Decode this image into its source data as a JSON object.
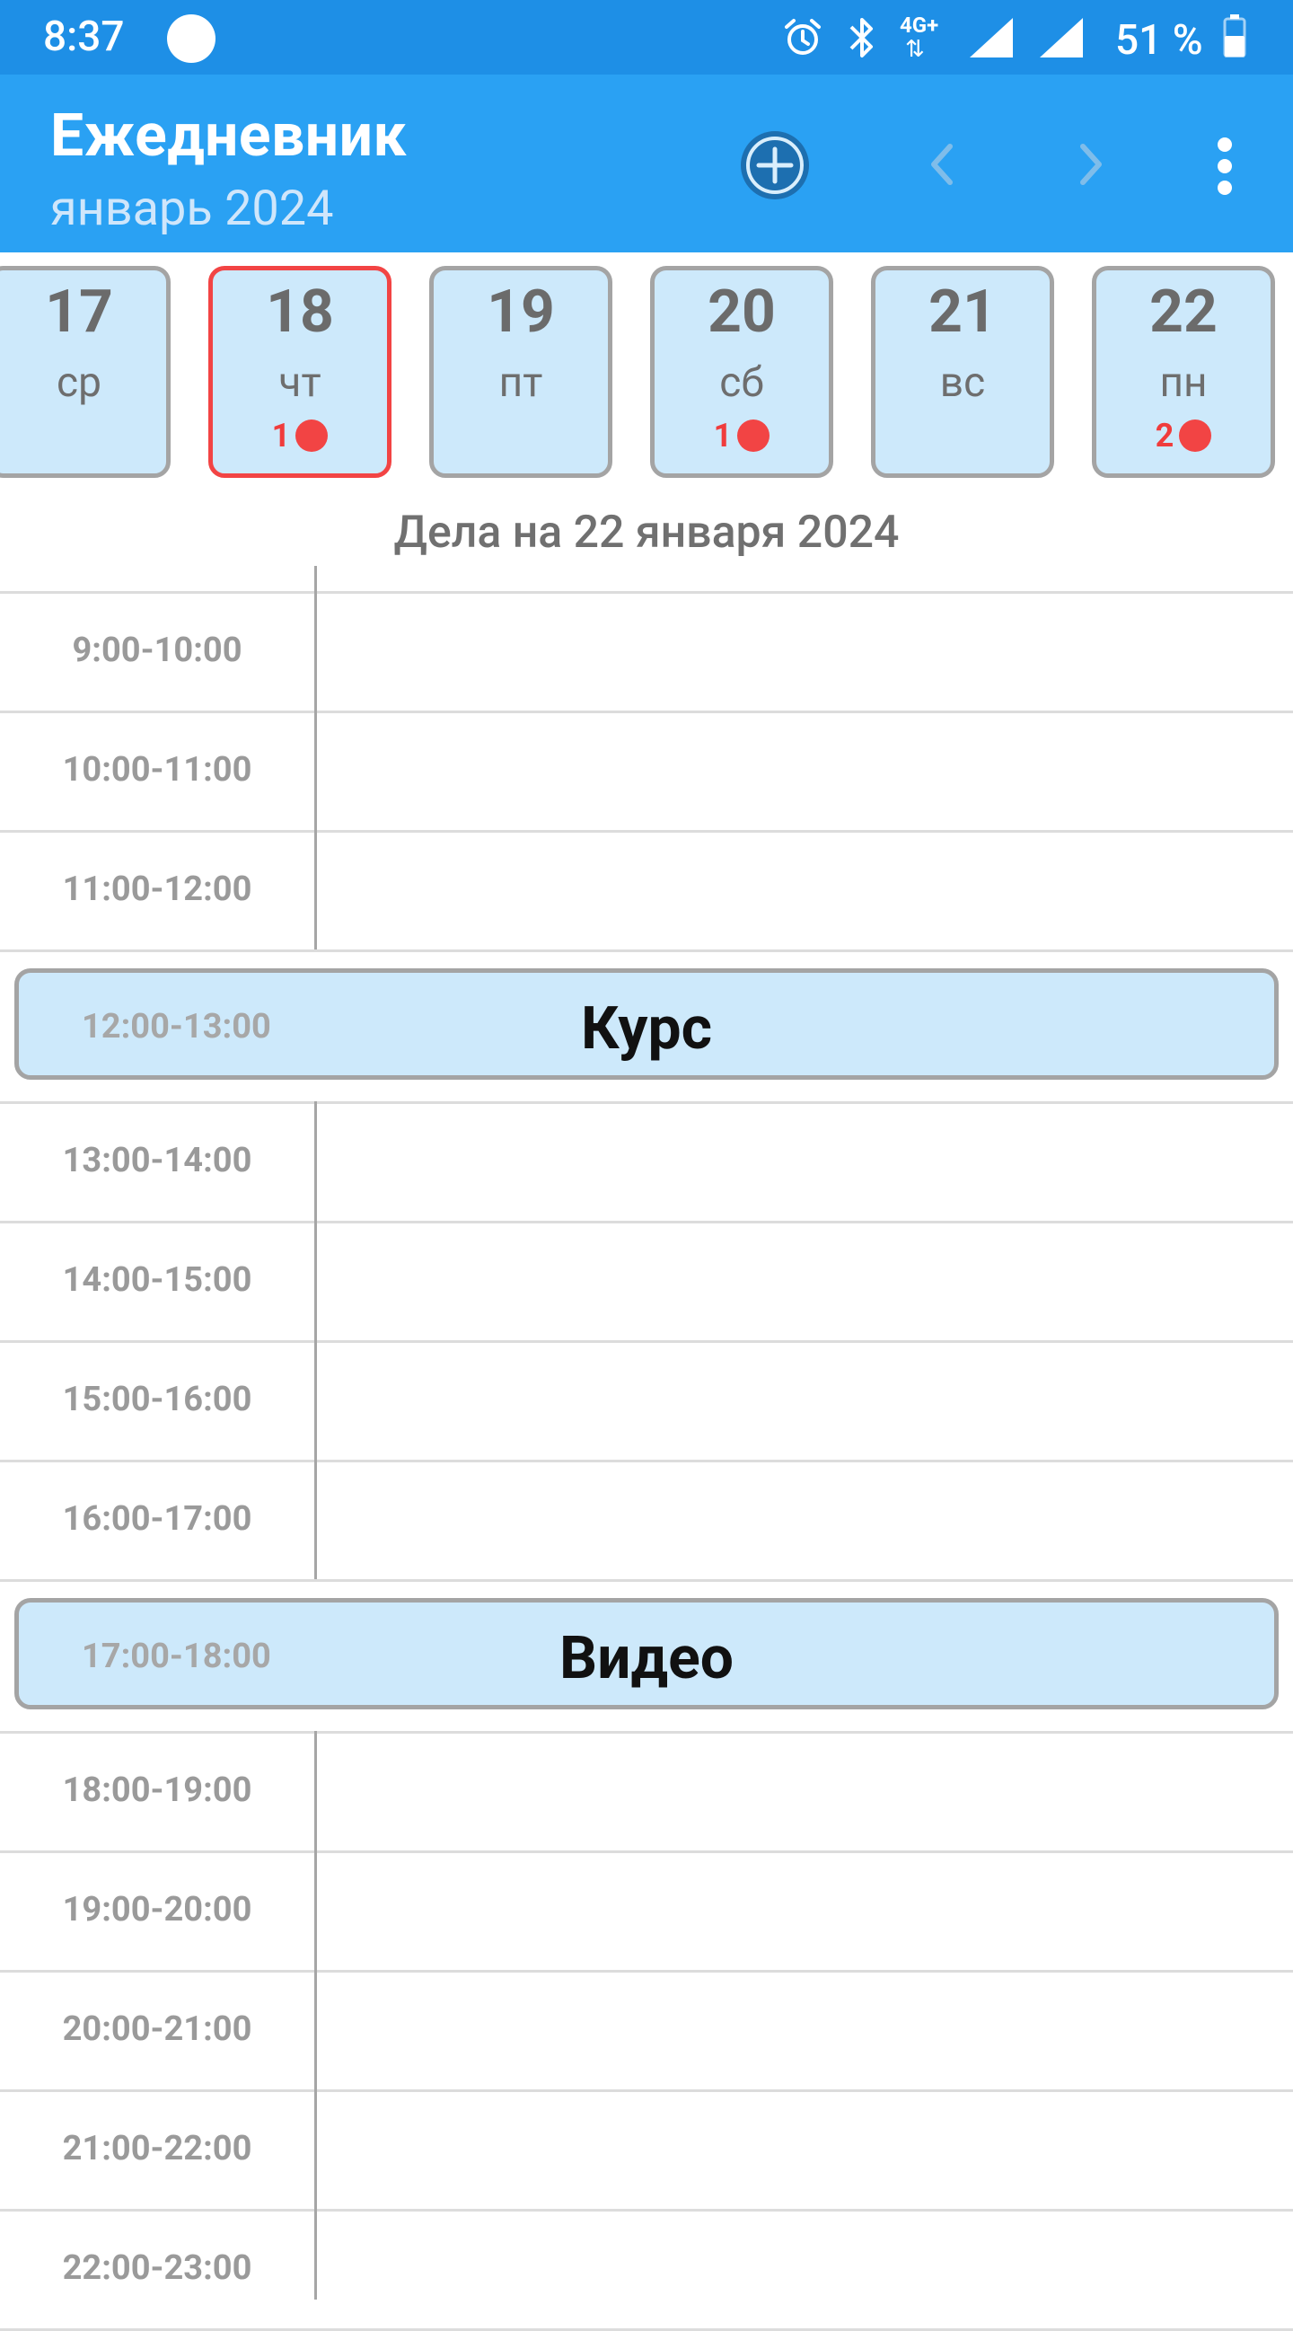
{
  "status_bar": {
    "time": "8:37",
    "network": "4G+",
    "battery": "51 %"
  },
  "app_bar": {
    "title": "Ежедневник",
    "subtitle": "январь 2024",
    "icons": [
      "add-circle-icon",
      "chevron-left-icon",
      "chevron-right-icon",
      "more-vert-icon"
    ]
  },
  "days": [
    {
      "num": "17",
      "weekday": "ср",
      "count": "",
      "selected": false
    },
    {
      "num": "18",
      "weekday": "чт",
      "count": "1",
      "selected": true
    },
    {
      "num": "19",
      "weekday": "пт",
      "count": "",
      "selected": false
    },
    {
      "num": "20",
      "weekday": "сб",
      "count": "1",
      "selected": false
    },
    {
      "num": "21",
      "weekday": "вс",
      "count": "",
      "selected": false
    },
    {
      "num": "22",
      "weekday": "пн",
      "count": "2",
      "selected": false
    }
  ],
  "schedule_header": "Дела на 22 января 2024",
  "slots": [
    "9:00-10:00",
    "10:00-11:00",
    "11:00-12:00",
    "12:00-13:00",
    "13:00-14:00",
    "14:00-15:00",
    "15:00-16:00",
    "16:00-17:00",
    "17:00-18:00",
    "18:00-19:00",
    "19:00-20:00",
    "20:00-21:00",
    "21:00-22:00",
    "22:00-23:00"
  ],
  "events": [
    {
      "time": "12:00-13:00",
      "title": "Курс"
    },
    {
      "time": "17:00-18:00",
      "title": "Видео"
    }
  ],
  "colors": {
    "status_bar": "#1e8fe6",
    "app_bar": "#2aa1f3",
    "card_bg": "#cde9fb",
    "selected_border": "#f24444",
    "badge": "#f24444"
  }
}
